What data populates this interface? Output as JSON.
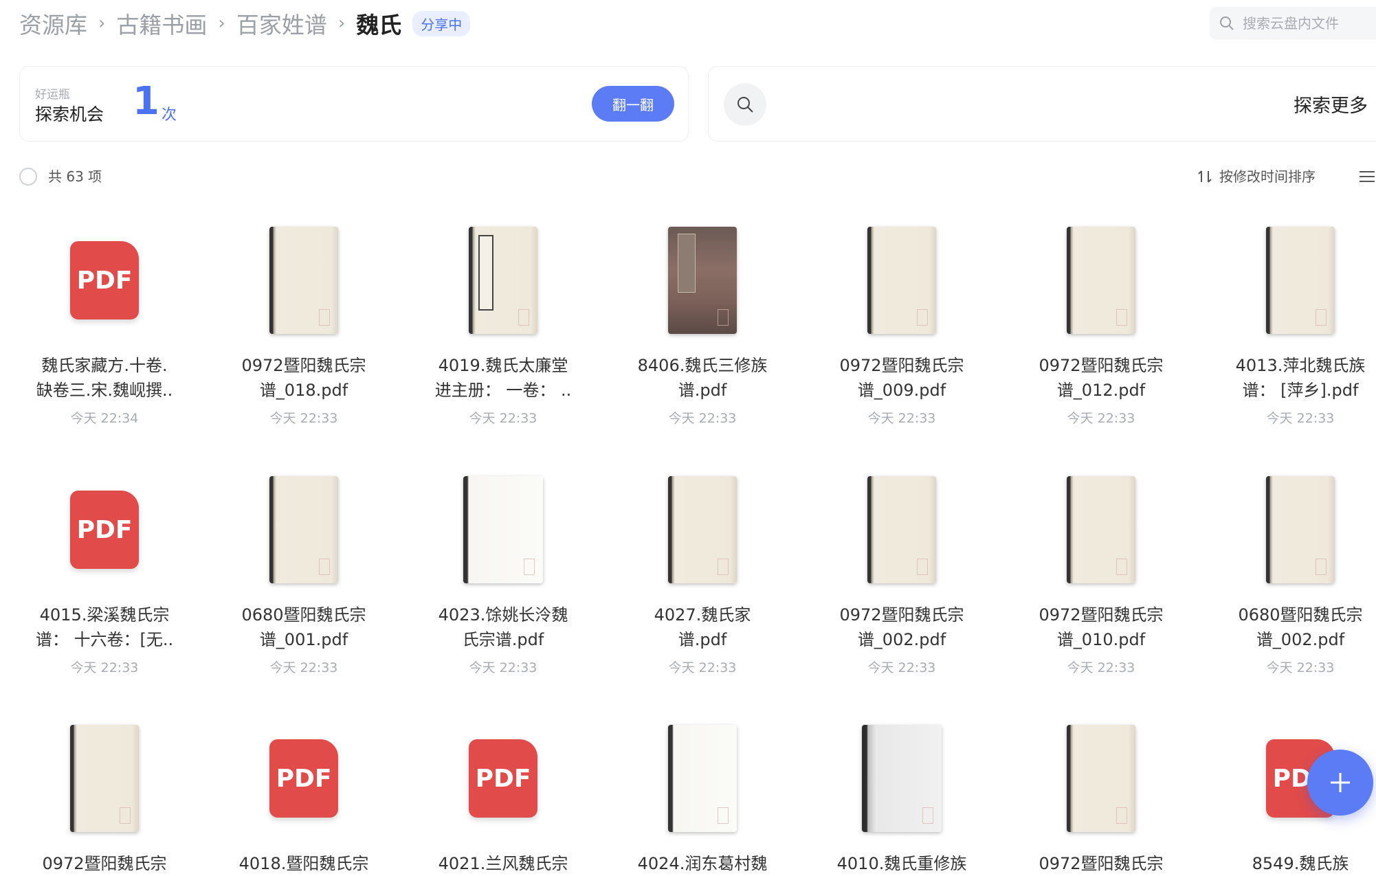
{
  "breadcrumb": {
    "items": [
      "资源库",
      "古籍书画",
      "百家姓谱"
    ],
    "current": "魏氏",
    "badge": "分享中"
  },
  "search": {
    "placeholder": "搜索云盘内文件"
  },
  "lucky": {
    "subtitle": "好运瓶",
    "title": "探索机会",
    "count": "1",
    "unit": "次",
    "button": "翻一翻"
  },
  "explore": {
    "label": "探索更多"
  },
  "toolbar": {
    "count_label": "共 63 项",
    "sort_label": "按修改时间排序"
  },
  "files": [
    {
      "name": "魏氏家藏方.十卷.\n缺卷三.宋.魏岘撰..",
      "time": "今天 22:34",
      "thumb": "pdf"
    },
    {
      "name": "0972暨阳魏氏宗\n谱_018.pdf",
      "time": "今天 22:33",
      "thumb": "book"
    },
    {
      "name": "4019.魏氏太廉堂\n进主册： 一卷： ..",
      "time": "今天 22:33",
      "thumb": "book-label"
    },
    {
      "name": "8406.魏氏三修族\n谱.pdf",
      "time": "今天 22:33",
      "thumb": "book-dark"
    },
    {
      "name": "0972暨阳魏氏宗\n谱_009.pdf",
      "time": "今天 22:33",
      "thumb": "book"
    },
    {
      "name": "0972暨阳魏氏宗\n谱_012.pdf",
      "time": "今天 22:33",
      "thumb": "book"
    },
    {
      "name": "4013.萍北魏氏族\n谱： [萍乡].pdf",
      "time": "今天 22:33",
      "thumb": "book"
    },
    {
      "name": "4015.梁溪魏氏宗\n谱： 十六卷：[无..",
      "time": "今天 22:33",
      "thumb": "pdf"
    },
    {
      "name": "0680暨阳魏氏宗\n谱_001.pdf",
      "time": "今天 22:33",
      "thumb": "book"
    },
    {
      "name": "4023.馀姚长泠魏\n氏宗谱.pdf",
      "time": "今天 22:33",
      "thumb": "book-wide-white"
    },
    {
      "name": "4027.魏氏家\n谱.pdf",
      "time": "今天 22:33",
      "thumb": "book"
    },
    {
      "name": "0972暨阳魏氏宗\n谱_002.pdf",
      "time": "今天 22:33",
      "thumb": "book"
    },
    {
      "name": "0972暨阳魏氏宗\n谱_010.pdf",
      "time": "今天 22:33",
      "thumb": "book"
    },
    {
      "name": "0680暨阳魏氏宗\n谱_002.pdf",
      "time": "今天 22:33",
      "thumb": "book"
    },
    {
      "name": "0972暨阳魏氏宗",
      "time": "",
      "thumb": "book"
    },
    {
      "name": "4018.暨阳魏氏宗",
      "time": "",
      "thumb": "pdf"
    },
    {
      "name": "4021.兰风魏氏宗",
      "time": "",
      "thumb": "pdf"
    },
    {
      "name": "4024.润东葛村魏",
      "time": "",
      "thumb": "book-white"
    },
    {
      "name": "4010.魏氏重修族",
      "time": "",
      "thumb": "book-gray"
    },
    {
      "name": "0972暨阳魏氏宗",
      "time": "",
      "thumb": "book"
    },
    {
      "name": "8549.魏氏族",
      "time": "",
      "thumb": "pdf"
    }
  ],
  "pdf_label": "PDF",
  "colors": {
    "accent": "#5b7cf5",
    "pdf": "#e14b49"
  }
}
